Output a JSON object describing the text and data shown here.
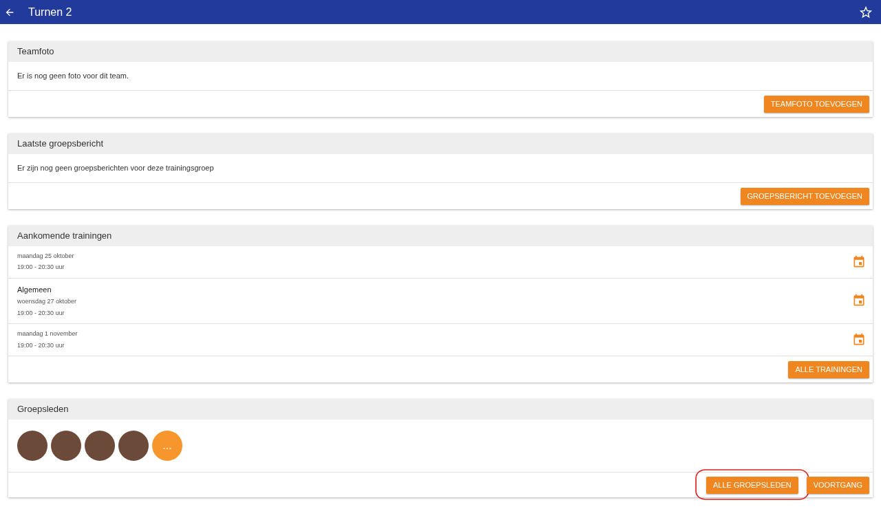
{
  "topbar": {
    "title": "Turnen 2"
  },
  "team_photo": {
    "title": "Teamfoto",
    "message": "Er is nog geen foto voor dit team.",
    "button": "TEAMFOTO TOEVOEGEN"
  },
  "group_message": {
    "title": "Laatste groepsbericht",
    "message": "Er zijn nog geen groepsberichten voor deze trainingsgroep",
    "button": "GROEPSBERICHT TOEVOEGEN"
  },
  "trainings": {
    "title": "Aankomende trainingen",
    "items": [
      {
        "date": "maandag 25 oktober",
        "time": "19:00 - 20:30 uur"
      },
      {
        "name": "Algemeen",
        "date": "woensdag 27 oktober",
        "time": "19:00 - 20:30 uur"
      },
      {
        "date": "maandag 1 november",
        "time": "19:00 - 20:30 uur"
      }
    ],
    "button": "ALLE TRAININGEN"
  },
  "members": {
    "title": "Groepsleden",
    "avatars": [
      {
        "kind": "photo"
      },
      {
        "kind": "photo"
      },
      {
        "kind": "photo"
      },
      {
        "kind": "photo"
      }
    ],
    "more": "...",
    "buttons": [
      {
        "label": "ALLE GROEPSLEDEN",
        "circled": true
      },
      {
        "label": "VOORTGANG",
        "circled": false
      }
    ]
  }
}
